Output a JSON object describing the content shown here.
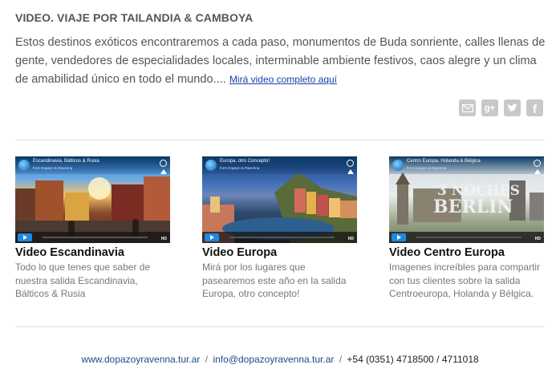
{
  "article": {
    "title": "VIDEO. VIAJE POR TAILANDIA & CAMBOYA",
    "body": "Estos destinos exóticos encontraremos a cada paso, monumentos de Buda sonriente, calles llenas de gente, vendedores de especialidades locales, interminable ambiente festivos, caos alegre y un clima de amabilidad único en todo el mundo....",
    "link": "Mirá video completo aquí"
  },
  "social": [
    "mail-icon",
    "google-plus-icon",
    "twitter-icon",
    "facebook-icon"
  ],
  "videos": [
    {
      "thumb_title": "Escandinavia, Bálticos & Rusia",
      "thumb_sub": "from Dopazo & Ravenna",
      "title": "Video Escandinavia",
      "desc": "Todo lo que tenes que saber de nuestra salida Escandinavia, Bálticos & Rusia"
    },
    {
      "thumb_title": "Europa, otro Concepto!",
      "thumb_sub": "from Dopazo & Ravenna",
      "title": "Video Europa",
      "desc": "Mirá por los lugares que pasearemos este año en la salida Europa, otro concepto!"
    },
    {
      "thumb_title": "Centro Europa, Holanda & Bélgica",
      "thumb_sub": "from Dopazo & Ravenna",
      "title": "Video Centro Europa",
      "desc": "Imagenes increíbles para compartir con tus clientes sobre la salida Centroeuropa, Holanda y Bélgica."
    }
  ],
  "footer": {
    "website": "www.dopazoyravenna.tur.ar",
    "email": "info@dopazoyravenna.tur.ar",
    "phone": "+54 (0351) 4718500 / 4711018",
    "sep": "/"
  },
  "colors": {
    "link": "#1a3fa8",
    "icon": "#c8c8c8",
    "play": "#1e88e5"
  }
}
